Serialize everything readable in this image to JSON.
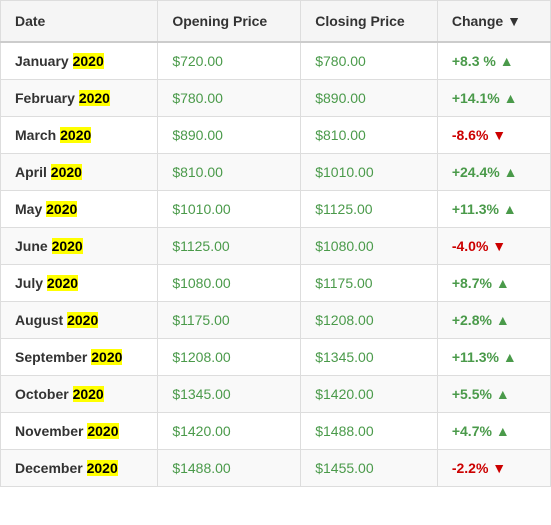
{
  "table": {
    "headers": [
      "Date",
      "Opening Price",
      "Closing Price",
      "Change ▼"
    ],
    "rows": [
      {
        "month": "January",
        "year": "2020",
        "opening": "$720.00",
        "closing": "$780.00",
        "change": "+8.3 %",
        "direction": "up"
      },
      {
        "month": "February",
        "year": "2020",
        "opening": "$780.00",
        "closing": "$890.00",
        "change": "+14.1%",
        "direction": "up"
      },
      {
        "month": "March",
        "year": "2020",
        "opening": "$890.00",
        "closing": "$810.00",
        "change": "-8.6%",
        "direction": "down"
      },
      {
        "month": "April",
        "year": "2020",
        "opening": "$810.00",
        "closing": "$1010.00",
        "change": "+24.4%",
        "direction": "up"
      },
      {
        "month": "May",
        "year": "2020",
        "opening": "$1010.00",
        "closing": "$1125.00",
        "change": "+11.3%",
        "direction": "up"
      },
      {
        "month": "June",
        "year": "2020",
        "opening": "$1125.00",
        "closing": "$1080.00",
        "change": "-4.0%",
        "direction": "down"
      },
      {
        "month": "July",
        "year": "2020",
        "opening": "$1080.00",
        "closing": "$1175.00",
        "change": "+8.7%",
        "direction": "up"
      },
      {
        "month": "August",
        "year": "2020",
        "opening": "$1175.00",
        "closing": "$1208.00",
        "change": "+2.8%",
        "direction": "up"
      },
      {
        "month": "September",
        "year": "2020",
        "opening": "$1208.00",
        "closing": "$1345.00",
        "change": "+11.3%",
        "direction": "up"
      },
      {
        "month": "October",
        "year": "2020",
        "opening": "$1345.00",
        "closing": "$1420.00",
        "change": "+5.5%",
        "direction": "up"
      },
      {
        "month": "November",
        "year": "2020",
        "opening": "$1420.00",
        "closing": "$1488.00",
        "change": "+4.7%",
        "direction": "up"
      },
      {
        "month": "December",
        "year": "2020",
        "opening": "$1488.00",
        "closing": "$1455.00",
        "change": "-2.2%",
        "direction": "down"
      }
    ]
  }
}
